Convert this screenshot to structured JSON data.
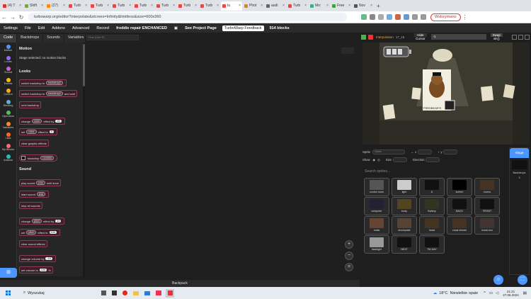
{
  "browser": {
    "tabs": [
      {
        "label": "(4) T",
        "color": "#d33"
      },
      {
        "label": "Shift",
        "color": "#7a3"
      },
      {
        "label": "(27)",
        "color": "#f80"
      },
      {
        "label": "Turb",
        "color": "#e44"
      },
      {
        "label": "Turb",
        "color": "#e44"
      },
      {
        "label": "Turb",
        "color": "#e44"
      },
      {
        "label": "Turb",
        "color": "#e44"
      },
      {
        "label": "Turb",
        "color": "#e44"
      },
      {
        "label": "Turb",
        "color": "#e44"
      },
      {
        "label": "Turb",
        "color": "#e44"
      },
      {
        "label": "tu",
        "color": "#e44"
      },
      {
        "label": "Phot",
        "color": "#c83"
      },
      {
        "label": "audi",
        "color": "#666"
      },
      {
        "label": "Turb",
        "color": "#e44"
      },
      {
        "label": "Mo:",
        "color": "#4a8"
      },
      {
        "label": "Free",
        "color": "#3a3"
      },
      {
        "label": "Nov",
        "color": "#555"
      }
    ],
    "active_tab_index": 10,
    "url": "turbowarp.org/editor?interpolate&stcrees=Infinity&limitless&size=600x360",
    "profile": "Wstrzymano"
  },
  "menubar": {
    "items": [
      "Settings",
      "File",
      "Edit",
      "Addons",
      "Advanced",
      "Record"
    ],
    "project_title": "freddie repair ENCHANCED",
    "see_project": "See Project Page",
    "feedback": "TurboWarp Feedback",
    "blocks_count": "914 blocks"
  },
  "editor_tabs": [
    "Code",
    "Backdrops",
    "Sounds",
    "Variables"
  ],
  "categories": [
    {
      "label": "Motion",
      "color": "#4c97ff"
    },
    {
      "label": "Looks",
      "color": "#9966ff"
    },
    {
      "label": "Sound",
      "color": "#cf63cf"
    },
    {
      "label": "Events",
      "color": "#ffbf00"
    },
    {
      "label": "Control",
      "color": "#ffab19"
    },
    {
      "label": "Sensing",
      "color": "#5cb1d6"
    },
    {
      "label": "Operators",
      "color": "#59c059"
    },
    {
      "label": "Variables",
      "color": "#ff8c1a"
    },
    {
      "label": "Lists",
      "color": "#ff661a"
    },
    {
      "label": "My Blocks",
      "color": "#ff6680"
    },
    {
      "label": "Addons",
      "color": "#29beb8"
    }
  ],
  "palette": {
    "motion_head": "Motion",
    "motion_text": "Stage selected: no motion blocks",
    "looks_head": "Looks",
    "sound_head": "Sound",
    "blocks": {
      "switch_backdrop": "switch backdrop to",
      "backdrop_val": "backdrop2",
      "switch_wait": "switch backdrop to",
      "and_wait": "and wait",
      "next_backdrop": "next backdrop",
      "change": "change",
      "color": "color",
      "effect_by": "effect by",
      "v25": "25",
      "set": "set",
      "effect_to": "effect to",
      "v0": "0",
      "clear_graphic": "clear graphic effects",
      "backdrop_rep": "backdrop",
      "number": "number",
      "play_sound": "play sound",
      "pop": "pop",
      "until_done": "until done",
      "start_sound": "start sound",
      "stop_all": "stop all sounds",
      "pitch": "pitch",
      "v10": "10",
      "v100": "100",
      "clear_sound": "clear sound effects",
      "change_vol": "change volume by",
      "vneg10": "-10",
      "set_vol": "set volume to",
      "pct": "%"
    }
  },
  "workspace": {
    "find_placeholder": "Find (Ctrl+F)",
    "zoom_in": "+",
    "zoom_out": "−",
    "zoom_reset": "="
  },
  "backpack": "Backpack",
  "stage_header": {
    "interp": "Interpolation",
    "fps": "17_15",
    "hide": "Hide",
    "cursor": "Cursor",
    "var_value": "-1",
    "swap": "Swap",
    "sin": "sin()"
  },
  "stage_scene": {
    "poster_label": "FREDBEAR'S"
  },
  "sprite_info": {
    "sprite_label": "Sprite",
    "sprite_name": "Name",
    "x_label": "x",
    "y_label": "y",
    "show_label": "Show",
    "size_label": "Size",
    "direction_label": "Direction"
  },
  "search_placeholder": "Search sprites...",
  "sprites": [
    {
      "name": "control room",
      "color": "#555"
    },
    {
      "name": "light",
      "color": "#ccc"
    },
    {
      "name": "A",
      "color": "#111"
    },
    {
      "name": "screen",
      "color": "#000"
    },
    {
      "name": "rooms",
      "color": "#432"
    },
    {
      "name": "computer",
      "color": "#223"
    },
    {
      "name": "body",
      "color": "#542"
    },
    {
      "name": "Battery",
      "color": "#332"
    },
    {
      "name": "BACK",
      "color": "#111"
    },
    {
      "name": "FRONT",
      "color": "#111"
    },
    {
      "name": "mask",
      "color": "#643"
    },
    {
      "name": "shockplate",
      "color": "#543"
    },
    {
      "name": "head",
      "color": "#432"
    },
    {
      "name": "vocal chords",
      "color": "#432"
    },
    {
      "name": "music box",
      "color": "#433"
    },
    {
      "name": "flashlight",
      "color": "#999"
    },
    {
      "name": "NEXT",
      "color": "#111"
    },
    {
      "name": "7W-DAY",
      "color": "#111"
    }
  ],
  "stage_panel": {
    "title": "Stage",
    "backdrops_label": "Backdrops",
    "backdrops_count": "3"
  },
  "taskbar": {
    "search": "Wyszukaj",
    "weather_temp": "18°C",
    "weather_text": "Niewielkie opaie",
    "time": "21:21",
    "date": "27.06.2024"
  }
}
